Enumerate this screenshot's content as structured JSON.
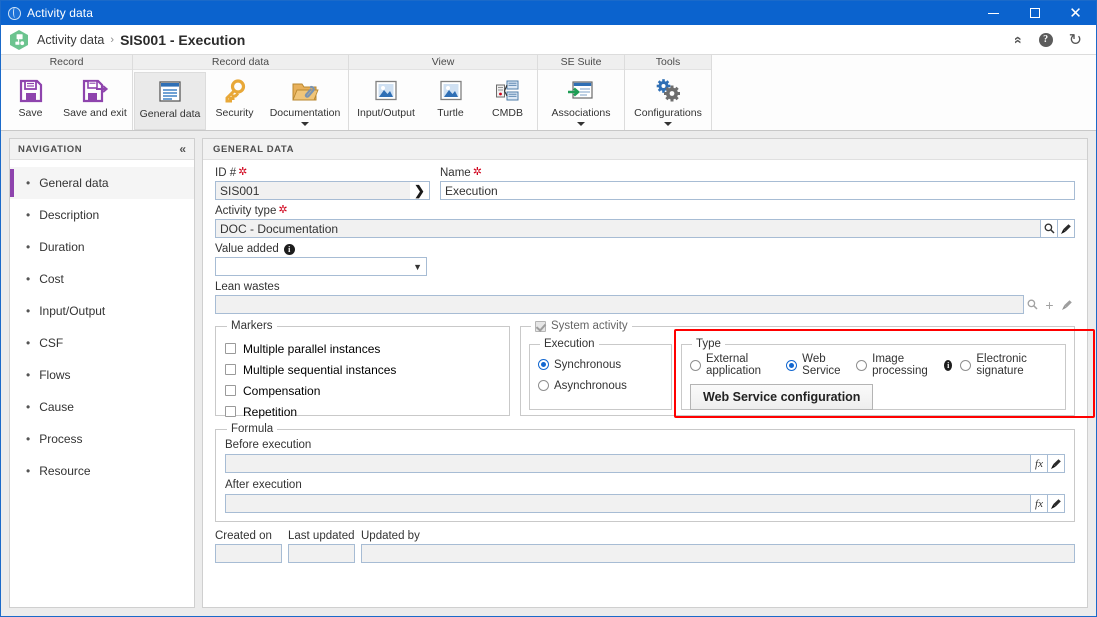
{
  "window": {
    "title": "Activity data",
    "icon": "globe-icon",
    "minimize_label": "Minimize",
    "maximize_label": "Maximize",
    "close_label": "Close"
  },
  "header": {
    "app_icon": "process-hexagon-icon",
    "breadcrumb_root": "Activity data",
    "breadcrumb_sep": "›",
    "title": "SIS001 - Execution",
    "actions": [
      {
        "name": "collapse-ribbon-icon",
        "glyph": "«"
      },
      {
        "name": "help-icon",
        "glyph": "?"
      },
      {
        "name": "refresh-icon",
        "glyph": "↻"
      }
    ]
  },
  "ribbon": {
    "groups": [
      {
        "title": "Record",
        "buttons": [
          {
            "label": "Save",
            "icon": "save-icon",
            "active": false,
            "caret": false
          },
          {
            "label": "Save and exit",
            "icon": "save-and-exit-icon",
            "active": false,
            "caret": false
          }
        ]
      },
      {
        "title": "Record data",
        "buttons": [
          {
            "label": "General data",
            "icon": "general-data-icon",
            "active": true,
            "caret": false
          },
          {
            "label": "Security",
            "icon": "key-icon",
            "active": false,
            "caret": false
          },
          {
            "label": "Documentation",
            "icon": "documentation-folder-icon",
            "active": false,
            "caret": true
          }
        ]
      },
      {
        "title": "View",
        "buttons": [
          {
            "label": "Input/Output",
            "icon": "image-icon",
            "active": false,
            "caret": false
          },
          {
            "label": "Turtle",
            "icon": "image-icon",
            "active": false,
            "caret": false
          },
          {
            "label": "CMDB",
            "icon": "cmdb-network-icon",
            "active": false,
            "caret": false
          }
        ]
      },
      {
        "title": "SE Suite",
        "buttons": [
          {
            "label": "Associations",
            "icon": "associations-icon",
            "active": false,
            "caret": true
          }
        ]
      },
      {
        "title": "Tools",
        "buttons": [
          {
            "label": "Configurations",
            "icon": "gears-icon",
            "active": false,
            "caret": true
          }
        ]
      }
    ]
  },
  "sidebar": {
    "title": "NAVIGATION",
    "collapse_glyph": "«",
    "items": [
      {
        "label": "General data",
        "selected": true
      },
      {
        "label": "Description",
        "selected": false
      },
      {
        "label": "Duration",
        "selected": false
      },
      {
        "label": "Cost",
        "selected": false
      },
      {
        "label": "Input/Output",
        "selected": false
      },
      {
        "label": "CSF",
        "selected": false
      },
      {
        "label": "Flows",
        "selected": false
      },
      {
        "label": "Cause",
        "selected": false
      },
      {
        "label": "Process",
        "selected": false
      },
      {
        "label": "Resource",
        "selected": false
      }
    ]
  },
  "main": {
    "section_title": "GENERAL DATA",
    "fields": {
      "id": {
        "label": "ID #",
        "value": "SIS001",
        "required": true,
        "arrow_glyph": "❯"
      },
      "name": {
        "label": "Name",
        "value": "Execution",
        "required": true
      },
      "activity_type": {
        "label": "Activity type",
        "value": "DOC - Documentation",
        "required": true
      },
      "value_added": {
        "label": "Value added",
        "value": "",
        "has_info": true,
        "options": [
          ""
        ]
      },
      "lean_wastes": {
        "label": "Lean wastes",
        "value": ""
      }
    },
    "markers": {
      "legend": "Markers",
      "items": [
        {
          "label": "Multiple parallel instances",
          "checked": false
        },
        {
          "label": "Multiple sequential instances",
          "checked": false
        },
        {
          "label": "Compensation",
          "checked": false
        },
        {
          "label": "Repetition",
          "checked": false
        }
      ]
    },
    "system_activity": {
      "legend": "System activity",
      "checked": true,
      "disabled": true,
      "execution": {
        "legend": "Execution",
        "options": [
          {
            "label": "Synchronous",
            "selected": true
          },
          {
            "label": "Asynchronous",
            "selected": false
          }
        ]
      },
      "type": {
        "legend": "Type",
        "highlighted": true,
        "highlight_color": "#ff0000",
        "options": [
          {
            "label": "External application",
            "selected": false,
            "has_info": false
          },
          {
            "label": "Web Service",
            "selected": true,
            "has_info": false
          },
          {
            "label": "Image processing",
            "selected": false,
            "has_info": true
          },
          {
            "label": "Electronic signature",
            "selected": false,
            "has_info": false
          }
        ],
        "config_button": "Web Service configuration"
      }
    },
    "formula": {
      "legend": "Formula",
      "before": {
        "label": "Before execution",
        "value": ""
      },
      "after": {
        "label": "After execution",
        "value": ""
      },
      "fx_label": "fx"
    },
    "audit": {
      "created_on": {
        "label": "Created on",
        "value": ""
      },
      "last_updated": {
        "label": "Last updated",
        "value": ""
      },
      "updated_by": {
        "label": "Updated by",
        "value": ""
      }
    }
  },
  "colors": {
    "titlebar": "#0b63ce",
    "accent_purple": "#8e44ad",
    "radio_blue": "#1267d0",
    "highlight_red": "#ff0000",
    "required_red": "#d0021b"
  }
}
